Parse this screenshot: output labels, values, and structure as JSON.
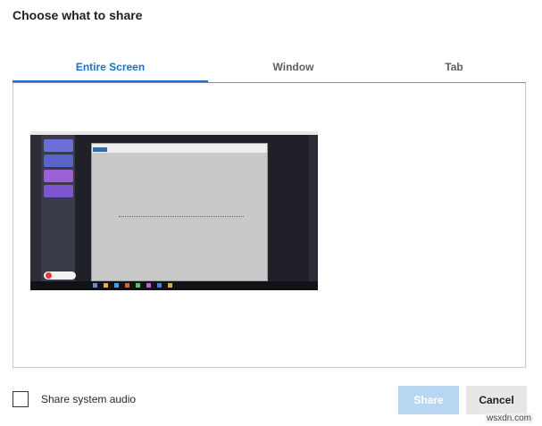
{
  "dialog": {
    "title": "Choose what to share"
  },
  "tabs": [
    {
      "label": "Entire Screen",
      "active": true
    },
    {
      "label": "Window",
      "active": false
    },
    {
      "label": "Tab",
      "active": false
    }
  ],
  "preview": {
    "kind": "screen-thumbnail"
  },
  "footer": {
    "audio_label": "Share system audio",
    "audio_checked": false,
    "share_label": "Share",
    "cancel_label": "Cancel",
    "share_enabled": false
  },
  "watermark": "wsxdn.com",
  "colors": {
    "accent": "#1a73c7",
    "share_disabled_bg": "#b8d6f2",
    "cancel_bg": "#e7e7e7"
  }
}
